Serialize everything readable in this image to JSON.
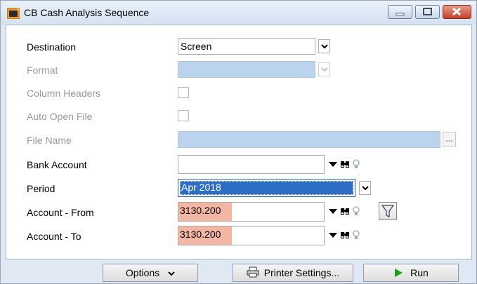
{
  "window": {
    "title": "CB Cash Analysis Sequence"
  },
  "form": {
    "destination": {
      "label": "Destination",
      "value": "Screen"
    },
    "format": {
      "label": "Format",
      "value": ""
    },
    "column_headers": {
      "label": "Column Headers",
      "checked": false
    },
    "auto_open_file": {
      "label": "Auto Open File",
      "checked": false
    },
    "file_name": {
      "label": "File Name",
      "value": ""
    },
    "bank_account": {
      "label": "Bank Account",
      "value": ""
    },
    "period": {
      "label": "Period",
      "value": "Apr 2018"
    },
    "account_from": {
      "label": "Account - From",
      "value": "3130.200"
    },
    "account_to": {
      "label": "Account - To",
      "value": "3130.200"
    }
  },
  "footer": {
    "options_label": "Options",
    "printer_settings_label": "Printer Settings...",
    "run_label": "Run"
  },
  "colors": {
    "disabled_field": "#bcd3ee",
    "highlight_pink": "#f4b6a4",
    "selection": "#2d6ec4",
    "run_icon": "#1aa01a"
  },
  "icons": [
    "app-icon",
    "minimize-icon",
    "maximize-icon",
    "close-icon",
    "chevron-down-icon",
    "binoculars-icon",
    "lightbulb-icon",
    "filter-icon",
    "printer-icon",
    "play-icon",
    "ellipsis-icon"
  ]
}
